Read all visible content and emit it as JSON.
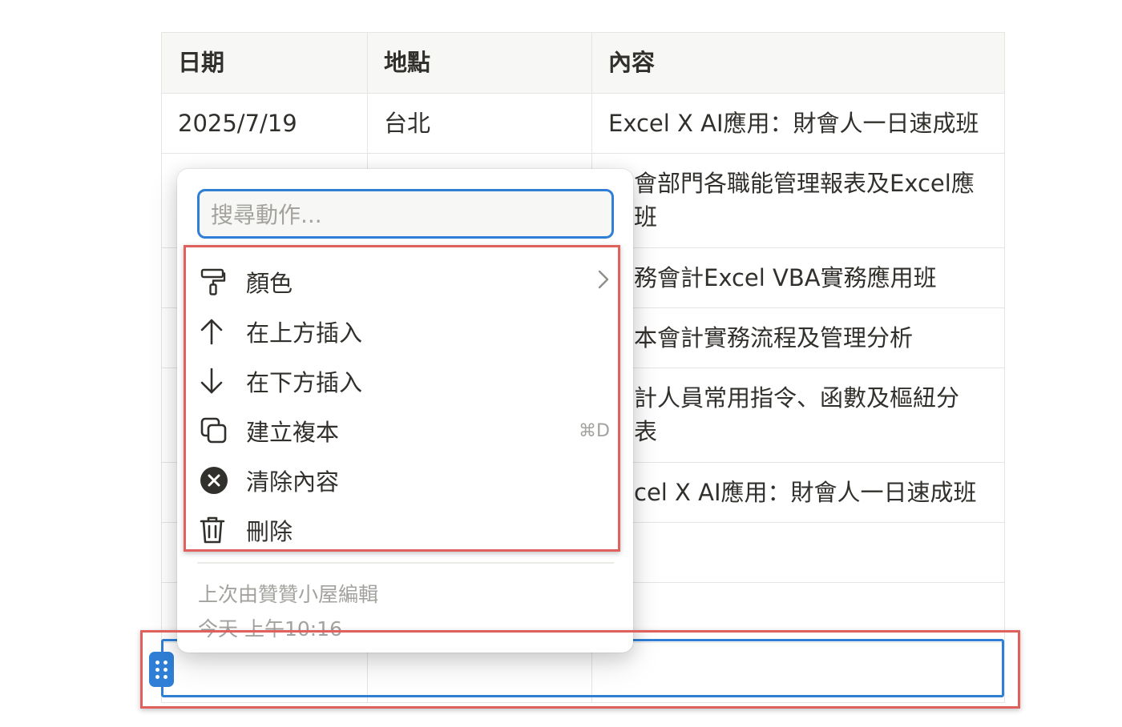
{
  "table": {
    "headers": [
      "日期",
      "地點",
      "內容"
    ],
    "rows": [
      [
        "2025/7/19",
        "台北",
        "Excel X AI應用：財會人一日速成班"
      ],
      [
        "",
        "",
        "會部門各職能管理報表及Excel應\n班"
      ],
      [
        "",
        "",
        "務會計Excel VBA實務應用班"
      ],
      [
        "",
        "",
        "本會計實務流程及管理分析"
      ],
      [
        "",
        "",
        "計人員常用指令、函數及樞紐分\n表"
      ],
      [
        "",
        "",
        "cel X AI應用：財會人一日速成班"
      ],
      [
        "",
        "",
        ""
      ],
      [
        "",
        "",
        ""
      ],
      [
        "",
        "",
        ""
      ]
    ]
  },
  "menu": {
    "search_placeholder": "搜尋動作...",
    "items": [
      {
        "label": "顏色",
        "icon": "paint-roller-icon",
        "has_submenu": true
      },
      {
        "label": "在上方插入",
        "icon": "arrow-up-icon"
      },
      {
        "label": "在下方插入",
        "icon": "arrow-down-icon"
      },
      {
        "label": "建立複本",
        "icon": "duplicate-icon",
        "shortcut": "⌘D"
      },
      {
        "label": "清除內容",
        "icon": "clear-circle-icon"
      },
      {
        "label": "刪除",
        "icon": "trash-icon"
      }
    ],
    "last_edited_by": "上次由贊贊小屋編輯",
    "last_edited_time": "今天 上午10:16"
  },
  "colors": {
    "accent": "#2f7fd6",
    "annotation": "#e0605d"
  }
}
